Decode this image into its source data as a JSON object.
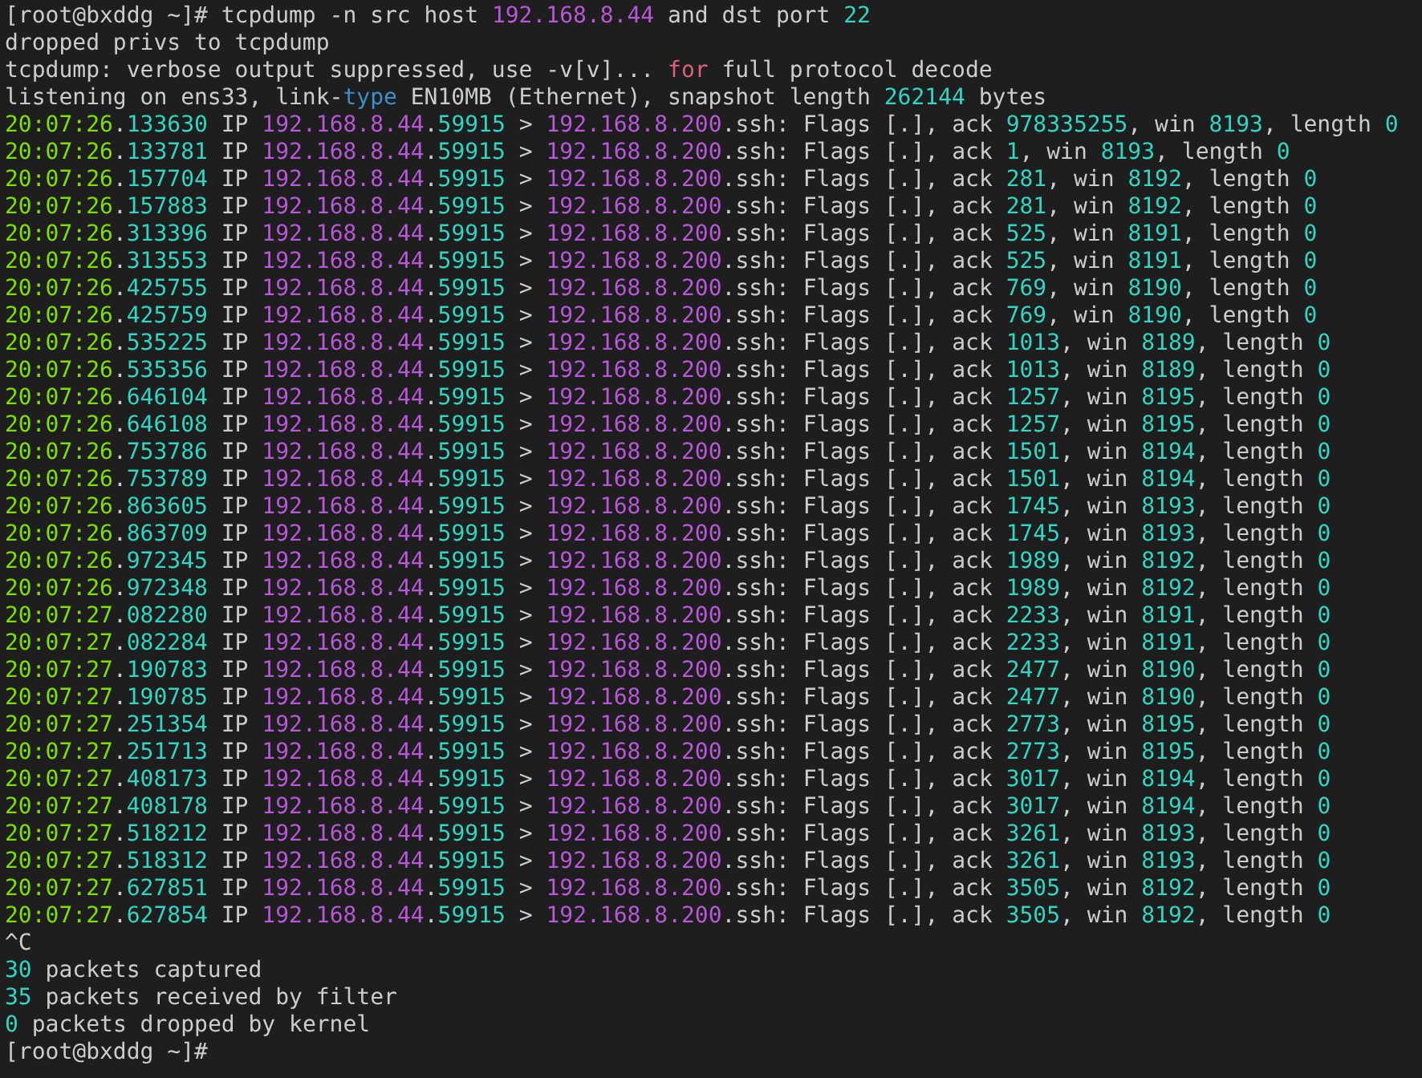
{
  "terminal": {
    "lines": [
      [
        {
          "text": "[root@bxddg ~]# tcpdump -n src host ",
          "kind": "plain"
        },
        {
          "text": "192.168.8.44",
          "kind": "address"
        },
        {
          "text": " and dst port ",
          "kind": "plain"
        },
        {
          "text": "22",
          "kind": "number"
        }
      ],
      [
        {
          "text": "dropped privs to tcpdump",
          "kind": "plain"
        }
      ],
      [
        {
          "text": "tcpdump: verbose output suppressed, use -v[v]... ",
          "kind": "plain"
        },
        {
          "text": "for",
          "kind": "keyword"
        },
        {
          "text": " full protocol decode",
          "kind": "plain"
        }
      ],
      [
        {
          "text": "listening on ens33, link-",
          "kind": "plain"
        },
        {
          "text": "type",
          "kind": "type"
        },
        {
          "text": " EN10MB (Ethernet), snapshot length ",
          "kind": "plain"
        },
        {
          "text": "262144",
          "kind": "number"
        },
        {
          "text": " bytes",
          "kind": "plain"
        }
      ],
      [
        {
          "text": "20:07:26",
          "kind": "time"
        },
        {
          "text": ".",
          "kind": "plain"
        },
        {
          "text": "133630",
          "kind": "number"
        },
        {
          "text": " IP ",
          "kind": "plain"
        },
        {
          "text": "192.168.8.44",
          "kind": "address"
        },
        {
          "text": ".",
          "kind": "plain"
        },
        {
          "text": "59915",
          "kind": "number"
        },
        {
          "text": " > ",
          "kind": "plain"
        },
        {
          "text": "192.168.8.200",
          "kind": "address"
        },
        {
          "text": ".ssh: Flags [.], ack ",
          "kind": "plain"
        },
        {
          "text": "978335255",
          "kind": "number"
        },
        {
          "text": ", win ",
          "kind": "plain"
        },
        {
          "text": "8193",
          "kind": "number"
        },
        {
          "text": ", length ",
          "kind": "plain"
        },
        {
          "text": "0",
          "kind": "number"
        }
      ],
      [
        {
          "text": "20:07:26",
          "kind": "time"
        },
        {
          "text": ".",
          "kind": "plain"
        },
        {
          "text": "133781",
          "kind": "number"
        },
        {
          "text": " IP ",
          "kind": "plain"
        },
        {
          "text": "192.168.8.44",
          "kind": "address"
        },
        {
          "text": ".",
          "kind": "plain"
        },
        {
          "text": "59915",
          "kind": "number"
        },
        {
          "text": " > ",
          "kind": "plain"
        },
        {
          "text": "192.168.8.200",
          "kind": "address"
        },
        {
          "text": ".ssh: Flags [.], ack ",
          "kind": "plain"
        },
        {
          "text": "1",
          "kind": "number"
        },
        {
          "text": ", win ",
          "kind": "plain"
        },
        {
          "text": "8193",
          "kind": "number"
        },
        {
          "text": ", length ",
          "kind": "plain"
        },
        {
          "text": "0",
          "kind": "number"
        }
      ],
      [
        {
          "text": "20:07:26",
          "kind": "time"
        },
        {
          "text": ".",
          "kind": "plain"
        },
        {
          "text": "157704",
          "kind": "number"
        },
        {
          "text": " IP ",
          "kind": "plain"
        },
        {
          "text": "192.168.8.44",
          "kind": "address"
        },
        {
          "text": ".",
          "kind": "plain"
        },
        {
          "text": "59915",
          "kind": "number"
        },
        {
          "text": " > ",
          "kind": "plain"
        },
        {
          "text": "192.168.8.200",
          "kind": "address"
        },
        {
          "text": ".ssh: Flags [.], ack ",
          "kind": "plain"
        },
        {
          "text": "281",
          "kind": "number"
        },
        {
          "text": ", win ",
          "kind": "plain"
        },
        {
          "text": "8192",
          "kind": "number"
        },
        {
          "text": ", length ",
          "kind": "plain"
        },
        {
          "text": "0",
          "kind": "number"
        }
      ],
      [
        {
          "text": "20:07:26",
          "kind": "time"
        },
        {
          "text": ".",
          "kind": "plain"
        },
        {
          "text": "157883",
          "kind": "number"
        },
        {
          "text": " IP ",
          "kind": "plain"
        },
        {
          "text": "192.168.8.44",
          "kind": "address"
        },
        {
          "text": ".",
          "kind": "plain"
        },
        {
          "text": "59915",
          "kind": "number"
        },
        {
          "text": " > ",
          "kind": "plain"
        },
        {
          "text": "192.168.8.200",
          "kind": "address"
        },
        {
          "text": ".ssh: Flags [.], ack ",
          "kind": "plain"
        },
        {
          "text": "281",
          "kind": "number"
        },
        {
          "text": ", win ",
          "kind": "plain"
        },
        {
          "text": "8192",
          "kind": "number"
        },
        {
          "text": ", length ",
          "kind": "plain"
        },
        {
          "text": "0",
          "kind": "number"
        }
      ],
      [
        {
          "text": "20:07:26",
          "kind": "time"
        },
        {
          "text": ".",
          "kind": "plain"
        },
        {
          "text": "313396",
          "kind": "number"
        },
        {
          "text": " IP ",
          "kind": "plain"
        },
        {
          "text": "192.168.8.44",
          "kind": "address"
        },
        {
          "text": ".",
          "kind": "plain"
        },
        {
          "text": "59915",
          "kind": "number"
        },
        {
          "text": " > ",
          "kind": "plain"
        },
        {
          "text": "192.168.8.200",
          "kind": "address"
        },
        {
          "text": ".ssh: Flags [.], ack ",
          "kind": "plain"
        },
        {
          "text": "525",
          "kind": "number"
        },
        {
          "text": ", win ",
          "kind": "plain"
        },
        {
          "text": "8191",
          "kind": "number"
        },
        {
          "text": ", length ",
          "kind": "plain"
        },
        {
          "text": "0",
          "kind": "number"
        }
      ],
      [
        {
          "text": "20:07:26",
          "kind": "time"
        },
        {
          "text": ".",
          "kind": "plain"
        },
        {
          "text": "313553",
          "kind": "number"
        },
        {
          "text": " IP ",
          "kind": "plain"
        },
        {
          "text": "192.168.8.44",
          "kind": "address"
        },
        {
          "text": ".",
          "kind": "plain"
        },
        {
          "text": "59915",
          "kind": "number"
        },
        {
          "text": " > ",
          "kind": "plain"
        },
        {
          "text": "192.168.8.200",
          "kind": "address"
        },
        {
          "text": ".ssh: Flags [.], ack ",
          "kind": "plain"
        },
        {
          "text": "525",
          "kind": "number"
        },
        {
          "text": ", win ",
          "kind": "plain"
        },
        {
          "text": "8191",
          "kind": "number"
        },
        {
          "text": ", length ",
          "kind": "plain"
        },
        {
          "text": "0",
          "kind": "number"
        }
      ],
      [
        {
          "text": "20:07:26",
          "kind": "time"
        },
        {
          "text": ".",
          "kind": "plain"
        },
        {
          "text": "425755",
          "kind": "number"
        },
        {
          "text": " IP ",
          "kind": "plain"
        },
        {
          "text": "192.168.8.44",
          "kind": "address"
        },
        {
          "text": ".",
          "kind": "plain"
        },
        {
          "text": "59915",
          "kind": "number"
        },
        {
          "text": " > ",
          "kind": "plain"
        },
        {
          "text": "192.168.8.200",
          "kind": "address"
        },
        {
          "text": ".ssh: Flags [.], ack ",
          "kind": "plain"
        },
        {
          "text": "769",
          "kind": "number"
        },
        {
          "text": ", win ",
          "kind": "plain"
        },
        {
          "text": "8190",
          "kind": "number"
        },
        {
          "text": ", length ",
          "kind": "plain"
        },
        {
          "text": "0",
          "kind": "number"
        }
      ],
      [
        {
          "text": "20:07:26",
          "kind": "time"
        },
        {
          "text": ".",
          "kind": "plain"
        },
        {
          "text": "425759",
          "kind": "number"
        },
        {
          "text": " IP ",
          "kind": "plain"
        },
        {
          "text": "192.168.8.44",
          "kind": "address"
        },
        {
          "text": ".",
          "kind": "plain"
        },
        {
          "text": "59915",
          "kind": "number"
        },
        {
          "text": " > ",
          "kind": "plain"
        },
        {
          "text": "192.168.8.200",
          "kind": "address"
        },
        {
          "text": ".ssh: Flags [.], ack ",
          "kind": "plain"
        },
        {
          "text": "769",
          "kind": "number"
        },
        {
          "text": ", win ",
          "kind": "plain"
        },
        {
          "text": "8190",
          "kind": "number"
        },
        {
          "text": ", length ",
          "kind": "plain"
        },
        {
          "text": "0",
          "kind": "number"
        }
      ],
      [
        {
          "text": "20:07:26",
          "kind": "time"
        },
        {
          "text": ".",
          "kind": "plain"
        },
        {
          "text": "535225",
          "kind": "number"
        },
        {
          "text": " IP ",
          "kind": "plain"
        },
        {
          "text": "192.168.8.44",
          "kind": "address"
        },
        {
          "text": ".",
          "kind": "plain"
        },
        {
          "text": "59915",
          "kind": "number"
        },
        {
          "text": " > ",
          "kind": "plain"
        },
        {
          "text": "192.168.8.200",
          "kind": "address"
        },
        {
          "text": ".ssh: Flags [.], ack ",
          "kind": "plain"
        },
        {
          "text": "1013",
          "kind": "number"
        },
        {
          "text": ", win ",
          "kind": "plain"
        },
        {
          "text": "8189",
          "kind": "number"
        },
        {
          "text": ", length ",
          "kind": "plain"
        },
        {
          "text": "0",
          "kind": "number"
        }
      ],
      [
        {
          "text": "20:07:26",
          "kind": "time"
        },
        {
          "text": ".",
          "kind": "plain"
        },
        {
          "text": "535356",
          "kind": "number"
        },
        {
          "text": " IP ",
          "kind": "plain"
        },
        {
          "text": "192.168.8.44",
          "kind": "address"
        },
        {
          "text": ".",
          "kind": "plain"
        },
        {
          "text": "59915",
          "kind": "number"
        },
        {
          "text": " > ",
          "kind": "plain"
        },
        {
          "text": "192.168.8.200",
          "kind": "address"
        },
        {
          "text": ".ssh: Flags [.], ack ",
          "kind": "plain"
        },
        {
          "text": "1013",
          "kind": "number"
        },
        {
          "text": ", win ",
          "kind": "plain"
        },
        {
          "text": "8189",
          "kind": "number"
        },
        {
          "text": ", length ",
          "kind": "plain"
        },
        {
          "text": "0",
          "kind": "number"
        }
      ],
      [
        {
          "text": "20:07:26",
          "kind": "time"
        },
        {
          "text": ".",
          "kind": "plain"
        },
        {
          "text": "646104",
          "kind": "number"
        },
        {
          "text": " IP ",
          "kind": "plain"
        },
        {
          "text": "192.168.8.44",
          "kind": "address"
        },
        {
          "text": ".",
          "kind": "plain"
        },
        {
          "text": "59915",
          "kind": "number"
        },
        {
          "text": " > ",
          "kind": "plain"
        },
        {
          "text": "192.168.8.200",
          "kind": "address"
        },
        {
          "text": ".ssh: Flags [.], ack ",
          "kind": "plain"
        },
        {
          "text": "1257",
          "kind": "number"
        },
        {
          "text": ", win ",
          "kind": "plain"
        },
        {
          "text": "8195",
          "kind": "number"
        },
        {
          "text": ", length ",
          "kind": "plain"
        },
        {
          "text": "0",
          "kind": "number"
        }
      ],
      [
        {
          "text": "20:07:26",
          "kind": "time"
        },
        {
          "text": ".",
          "kind": "plain"
        },
        {
          "text": "646108",
          "kind": "number"
        },
        {
          "text": " IP ",
          "kind": "plain"
        },
        {
          "text": "192.168.8.44",
          "kind": "address"
        },
        {
          "text": ".",
          "kind": "plain"
        },
        {
          "text": "59915",
          "kind": "number"
        },
        {
          "text": " > ",
          "kind": "plain"
        },
        {
          "text": "192.168.8.200",
          "kind": "address"
        },
        {
          "text": ".ssh: Flags [.], ack ",
          "kind": "plain"
        },
        {
          "text": "1257",
          "kind": "number"
        },
        {
          "text": ", win ",
          "kind": "plain"
        },
        {
          "text": "8195",
          "kind": "number"
        },
        {
          "text": ", length ",
          "kind": "plain"
        },
        {
          "text": "0",
          "kind": "number"
        }
      ],
      [
        {
          "text": "20:07:26",
          "kind": "time"
        },
        {
          "text": ".",
          "kind": "plain"
        },
        {
          "text": "753786",
          "kind": "number"
        },
        {
          "text": " IP ",
          "kind": "plain"
        },
        {
          "text": "192.168.8.44",
          "kind": "address"
        },
        {
          "text": ".",
          "kind": "plain"
        },
        {
          "text": "59915",
          "kind": "number"
        },
        {
          "text": " > ",
          "kind": "plain"
        },
        {
          "text": "192.168.8.200",
          "kind": "address"
        },
        {
          "text": ".ssh: Flags [.], ack ",
          "kind": "plain"
        },
        {
          "text": "1501",
          "kind": "number"
        },
        {
          "text": ", win ",
          "kind": "plain"
        },
        {
          "text": "8194",
          "kind": "number"
        },
        {
          "text": ", length ",
          "kind": "plain"
        },
        {
          "text": "0",
          "kind": "number"
        }
      ],
      [
        {
          "text": "20:07:26",
          "kind": "time"
        },
        {
          "text": ".",
          "kind": "plain"
        },
        {
          "text": "753789",
          "kind": "number"
        },
        {
          "text": " IP ",
          "kind": "plain"
        },
        {
          "text": "192.168.8.44",
          "kind": "address"
        },
        {
          "text": ".",
          "kind": "plain"
        },
        {
          "text": "59915",
          "kind": "number"
        },
        {
          "text": " > ",
          "kind": "plain"
        },
        {
          "text": "192.168.8.200",
          "kind": "address"
        },
        {
          "text": ".ssh: Flags [.], ack ",
          "kind": "plain"
        },
        {
          "text": "1501",
          "kind": "number"
        },
        {
          "text": ", win ",
          "kind": "plain"
        },
        {
          "text": "8194",
          "kind": "number"
        },
        {
          "text": ", length ",
          "kind": "plain"
        },
        {
          "text": "0",
          "kind": "number"
        }
      ],
      [
        {
          "text": "20:07:26",
          "kind": "time"
        },
        {
          "text": ".",
          "kind": "plain"
        },
        {
          "text": "863605",
          "kind": "number"
        },
        {
          "text": " IP ",
          "kind": "plain"
        },
        {
          "text": "192.168.8.44",
          "kind": "address"
        },
        {
          "text": ".",
          "kind": "plain"
        },
        {
          "text": "59915",
          "kind": "number"
        },
        {
          "text": " > ",
          "kind": "plain"
        },
        {
          "text": "192.168.8.200",
          "kind": "address"
        },
        {
          "text": ".ssh: Flags [.], ack ",
          "kind": "plain"
        },
        {
          "text": "1745",
          "kind": "number"
        },
        {
          "text": ", win ",
          "kind": "plain"
        },
        {
          "text": "8193",
          "kind": "number"
        },
        {
          "text": ", length ",
          "kind": "plain"
        },
        {
          "text": "0",
          "kind": "number"
        }
      ],
      [
        {
          "text": "20:07:26",
          "kind": "time"
        },
        {
          "text": ".",
          "kind": "plain"
        },
        {
          "text": "863709",
          "kind": "number"
        },
        {
          "text": " IP ",
          "kind": "plain"
        },
        {
          "text": "192.168.8.44",
          "kind": "address"
        },
        {
          "text": ".",
          "kind": "plain"
        },
        {
          "text": "59915",
          "kind": "number"
        },
        {
          "text": " > ",
          "kind": "plain"
        },
        {
          "text": "192.168.8.200",
          "kind": "address"
        },
        {
          "text": ".ssh: Flags [.], ack ",
          "kind": "plain"
        },
        {
          "text": "1745",
          "kind": "number"
        },
        {
          "text": ", win ",
          "kind": "plain"
        },
        {
          "text": "8193",
          "kind": "number"
        },
        {
          "text": ", length ",
          "kind": "plain"
        },
        {
          "text": "0",
          "kind": "number"
        }
      ],
      [
        {
          "text": "20:07:26",
          "kind": "time"
        },
        {
          "text": ".",
          "kind": "plain"
        },
        {
          "text": "972345",
          "kind": "number"
        },
        {
          "text": " IP ",
          "kind": "plain"
        },
        {
          "text": "192.168.8.44",
          "kind": "address"
        },
        {
          "text": ".",
          "kind": "plain"
        },
        {
          "text": "59915",
          "kind": "number"
        },
        {
          "text": " > ",
          "kind": "plain"
        },
        {
          "text": "192.168.8.200",
          "kind": "address"
        },
        {
          "text": ".ssh: Flags [.], ack ",
          "kind": "plain"
        },
        {
          "text": "1989",
          "kind": "number"
        },
        {
          "text": ", win ",
          "kind": "plain"
        },
        {
          "text": "8192",
          "kind": "number"
        },
        {
          "text": ", length ",
          "kind": "plain"
        },
        {
          "text": "0",
          "kind": "number"
        }
      ],
      [
        {
          "text": "20:07:26",
          "kind": "time"
        },
        {
          "text": ".",
          "kind": "plain"
        },
        {
          "text": "972348",
          "kind": "number"
        },
        {
          "text": " IP ",
          "kind": "plain"
        },
        {
          "text": "192.168.8.44",
          "kind": "address"
        },
        {
          "text": ".",
          "kind": "plain"
        },
        {
          "text": "59915",
          "kind": "number"
        },
        {
          "text": " > ",
          "kind": "plain"
        },
        {
          "text": "192.168.8.200",
          "kind": "address"
        },
        {
          "text": ".ssh: Flags [.], ack ",
          "kind": "plain"
        },
        {
          "text": "1989",
          "kind": "number"
        },
        {
          "text": ", win ",
          "kind": "plain"
        },
        {
          "text": "8192",
          "kind": "number"
        },
        {
          "text": ", length ",
          "kind": "plain"
        },
        {
          "text": "0",
          "kind": "number"
        }
      ],
      [
        {
          "text": "20:07:27",
          "kind": "time"
        },
        {
          "text": ".",
          "kind": "plain"
        },
        {
          "text": "082280",
          "kind": "number"
        },
        {
          "text": " IP ",
          "kind": "plain"
        },
        {
          "text": "192.168.8.44",
          "kind": "address"
        },
        {
          "text": ".",
          "kind": "plain"
        },
        {
          "text": "59915",
          "kind": "number"
        },
        {
          "text": " > ",
          "kind": "plain"
        },
        {
          "text": "192.168.8.200",
          "kind": "address"
        },
        {
          "text": ".ssh: Flags [.], ack ",
          "kind": "plain"
        },
        {
          "text": "2233",
          "kind": "number"
        },
        {
          "text": ", win ",
          "kind": "plain"
        },
        {
          "text": "8191",
          "kind": "number"
        },
        {
          "text": ", length ",
          "kind": "plain"
        },
        {
          "text": "0",
          "kind": "number"
        }
      ],
      [
        {
          "text": "20:07:27",
          "kind": "time"
        },
        {
          "text": ".",
          "kind": "plain"
        },
        {
          "text": "082284",
          "kind": "number"
        },
        {
          "text": " IP ",
          "kind": "plain"
        },
        {
          "text": "192.168.8.44",
          "kind": "address"
        },
        {
          "text": ".",
          "kind": "plain"
        },
        {
          "text": "59915",
          "kind": "number"
        },
        {
          "text": " > ",
          "kind": "plain"
        },
        {
          "text": "192.168.8.200",
          "kind": "address"
        },
        {
          "text": ".ssh: Flags [.], ack ",
          "kind": "plain"
        },
        {
          "text": "2233",
          "kind": "number"
        },
        {
          "text": ", win ",
          "kind": "plain"
        },
        {
          "text": "8191",
          "kind": "number"
        },
        {
          "text": ", length ",
          "kind": "plain"
        },
        {
          "text": "0",
          "kind": "number"
        }
      ],
      [
        {
          "text": "20:07:27",
          "kind": "time"
        },
        {
          "text": ".",
          "kind": "plain"
        },
        {
          "text": "190783",
          "kind": "number"
        },
        {
          "text": " IP ",
          "kind": "plain"
        },
        {
          "text": "192.168.8.44",
          "kind": "address"
        },
        {
          "text": ".",
          "kind": "plain"
        },
        {
          "text": "59915",
          "kind": "number"
        },
        {
          "text": " > ",
          "kind": "plain"
        },
        {
          "text": "192.168.8.200",
          "kind": "address"
        },
        {
          "text": ".ssh: Flags [.], ack ",
          "kind": "plain"
        },
        {
          "text": "2477",
          "kind": "number"
        },
        {
          "text": ", win ",
          "kind": "plain"
        },
        {
          "text": "8190",
          "kind": "number"
        },
        {
          "text": ", length ",
          "kind": "plain"
        },
        {
          "text": "0",
          "kind": "number"
        }
      ],
      [
        {
          "text": "20:07:27",
          "kind": "time"
        },
        {
          "text": ".",
          "kind": "plain"
        },
        {
          "text": "190785",
          "kind": "number"
        },
        {
          "text": " IP ",
          "kind": "plain"
        },
        {
          "text": "192.168.8.44",
          "kind": "address"
        },
        {
          "text": ".",
          "kind": "plain"
        },
        {
          "text": "59915",
          "kind": "number"
        },
        {
          "text": " > ",
          "kind": "plain"
        },
        {
          "text": "192.168.8.200",
          "kind": "address"
        },
        {
          "text": ".ssh: Flags [.], ack ",
          "kind": "plain"
        },
        {
          "text": "2477",
          "kind": "number"
        },
        {
          "text": ", win ",
          "kind": "plain"
        },
        {
          "text": "8190",
          "kind": "number"
        },
        {
          "text": ", length ",
          "kind": "plain"
        },
        {
          "text": "0",
          "kind": "number"
        }
      ],
      [
        {
          "text": "20:07:27",
          "kind": "time"
        },
        {
          "text": ".",
          "kind": "plain"
        },
        {
          "text": "251354",
          "kind": "number"
        },
        {
          "text": " IP ",
          "kind": "plain"
        },
        {
          "text": "192.168.8.44",
          "kind": "address"
        },
        {
          "text": ".",
          "kind": "plain"
        },
        {
          "text": "59915",
          "kind": "number"
        },
        {
          "text": " > ",
          "kind": "plain"
        },
        {
          "text": "192.168.8.200",
          "kind": "address"
        },
        {
          "text": ".ssh: Flags [.], ack ",
          "kind": "plain"
        },
        {
          "text": "2773",
          "kind": "number"
        },
        {
          "text": ", win ",
          "kind": "plain"
        },
        {
          "text": "8195",
          "kind": "number"
        },
        {
          "text": ", length ",
          "kind": "plain"
        },
        {
          "text": "0",
          "kind": "number"
        }
      ],
      [
        {
          "text": "20:07:27",
          "kind": "time"
        },
        {
          "text": ".",
          "kind": "plain"
        },
        {
          "text": "251713",
          "kind": "number"
        },
        {
          "text": " IP ",
          "kind": "plain"
        },
        {
          "text": "192.168.8.44",
          "kind": "address"
        },
        {
          "text": ".",
          "kind": "plain"
        },
        {
          "text": "59915",
          "kind": "number"
        },
        {
          "text": " > ",
          "kind": "plain"
        },
        {
          "text": "192.168.8.200",
          "kind": "address"
        },
        {
          "text": ".ssh: Flags [.], ack ",
          "kind": "plain"
        },
        {
          "text": "2773",
          "kind": "number"
        },
        {
          "text": ", win ",
          "kind": "plain"
        },
        {
          "text": "8195",
          "kind": "number"
        },
        {
          "text": ", length ",
          "kind": "plain"
        },
        {
          "text": "0",
          "kind": "number"
        }
      ],
      [
        {
          "text": "20:07:27",
          "kind": "time"
        },
        {
          "text": ".",
          "kind": "plain"
        },
        {
          "text": "408173",
          "kind": "number"
        },
        {
          "text": " IP ",
          "kind": "plain"
        },
        {
          "text": "192.168.8.44",
          "kind": "address"
        },
        {
          "text": ".",
          "kind": "plain"
        },
        {
          "text": "59915",
          "kind": "number"
        },
        {
          "text": " > ",
          "kind": "plain"
        },
        {
          "text": "192.168.8.200",
          "kind": "address"
        },
        {
          "text": ".ssh: Flags [.], ack ",
          "kind": "plain"
        },
        {
          "text": "3017",
          "kind": "number"
        },
        {
          "text": ", win ",
          "kind": "plain"
        },
        {
          "text": "8194",
          "kind": "number"
        },
        {
          "text": ", length ",
          "kind": "plain"
        },
        {
          "text": "0",
          "kind": "number"
        }
      ],
      [
        {
          "text": "20:07:27",
          "kind": "time"
        },
        {
          "text": ".",
          "kind": "plain"
        },
        {
          "text": "408178",
          "kind": "number"
        },
        {
          "text": " IP ",
          "kind": "plain"
        },
        {
          "text": "192.168.8.44",
          "kind": "address"
        },
        {
          "text": ".",
          "kind": "plain"
        },
        {
          "text": "59915",
          "kind": "number"
        },
        {
          "text": " > ",
          "kind": "plain"
        },
        {
          "text": "192.168.8.200",
          "kind": "address"
        },
        {
          "text": ".ssh: Flags [.], ack ",
          "kind": "plain"
        },
        {
          "text": "3017",
          "kind": "number"
        },
        {
          "text": ", win ",
          "kind": "plain"
        },
        {
          "text": "8194",
          "kind": "number"
        },
        {
          "text": ", length ",
          "kind": "plain"
        },
        {
          "text": "0",
          "kind": "number"
        }
      ],
      [
        {
          "text": "20:07:27",
          "kind": "time"
        },
        {
          "text": ".",
          "kind": "plain"
        },
        {
          "text": "518212",
          "kind": "number"
        },
        {
          "text": " IP ",
          "kind": "plain"
        },
        {
          "text": "192.168.8.44",
          "kind": "address"
        },
        {
          "text": ".",
          "kind": "plain"
        },
        {
          "text": "59915",
          "kind": "number"
        },
        {
          "text": " > ",
          "kind": "plain"
        },
        {
          "text": "192.168.8.200",
          "kind": "address"
        },
        {
          "text": ".ssh: Flags [.], ack ",
          "kind": "plain"
        },
        {
          "text": "3261",
          "kind": "number"
        },
        {
          "text": ", win ",
          "kind": "plain"
        },
        {
          "text": "8193",
          "kind": "number"
        },
        {
          "text": ", length ",
          "kind": "plain"
        },
        {
          "text": "0",
          "kind": "number"
        }
      ],
      [
        {
          "text": "20:07:27",
          "kind": "time"
        },
        {
          "text": ".",
          "kind": "plain"
        },
        {
          "text": "518312",
          "kind": "number"
        },
        {
          "text": " IP ",
          "kind": "plain"
        },
        {
          "text": "192.168.8.44",
          "kind": "address"
        },
        {
          "text": ".",
          "kind": "plain"
        },
        {
          "text": "59915",
          "kind": "number"
        },
        {
          "text": " > ",
          "kind": "plain"
        },
        {
          "text": "192.168.8.200",
          "kind": "address"
        },
        {
          "text": ".ssh: Flags [.], ack ",
          "kind": "plain"
        },
        {
          "text": "3261",
          "kind": "number"
        },
        {
          "text": ", win ",
          "kind": "plain"
        },
        {
          "text": "8193",
          "kind": "number"
        },
        {
          "text": ", length ",
          "kind": "plain"
        },
        {
          "text": "0",
          "kind": "number"
        }
      ],
      [
        {
          "text": "20:07:27",
          "kind": "time"
        },
        {
          "text": ".",
          "kind": "plain"
        },
        {
          "text": "627851",
          "kind": "number"
        },
        {
          "text": " IP ",
          "kind": "plain"
        },
        {
          "text": "192.168.8.44",
          "kind": "address"
        },
        {
          "text": ".",
          "kind": "plain"
        },
        {
          "text": "59915",
          "kind": "number"
        },
        {
          "text": " > ",
          "kind": "plain"
        },
        {
          "text": "192.168.8.200",
          "kind": "address"
        },
        {
          "text": ".ssh: Flags [.], ack ",
          "kind": "plain"
        },
        {
          "text": "3505",
          "kind": "number"
        },
        {
          "text": ", win ",
          "kind": "plain"
        },
        {
          "text": "8192",
          "kind": "number"
        },
        {
          "text": ", length ",
          "kind": "plain"
        },
        {
          "text": "0",
          "kind": "number"
        }
      ],
      [
        {
          "text": "20:07:27",
          "kind": "time"
        },
        {
          "text": ".",
          "kind": "plain"
        },
        {
          "text": "627854",
          "kind": "number"
        },
        {
          "text": " IP ",
          "kind": "plain"
        },
        {
          "text": "192.168.8.44",
          "kind": "address"
        },
        {
          "text": ".",
          "kind": "plain"
        },
        {
          "text": "59915",
          "kind": "number"
        },
        {
          "text": " > ",
          "kind": "plain"
        },
        {
          "text": "192.168.8.200",
          "kind": "address"
        },
        {
          "text": ".ssh: Flags [.], ack ",
          "kind": "plain"
        },
        {
          "text": "3505",
          "kind": "number"
        },
        {
          "text": ", win ",
          "kind": "plain"
        },
        {
          "text": "8192",
          "kind": "number"
        },
        {
          "text": ", length ",
          "kind": "plain"
        },
        {
          "text": "0",
          "kind": "number"
        }
      ],
      [
        {
          "text": "^C",
          "kind": "plain"
        }
      ],
      [
        {
          "text": "30",
          "kind": "number"
        },
        {
          "text": " packets captured",
          "kind": "plain"
        }
      ],
      [
        {
          "text": "35",
          "kind": "number"
        },
        {
          "text": " packets received by filter",
          "kind": "plain"
        }
      ],
      [
        {
          "text": "0",
          "kind": "number"
        },
        {
          "text": " packets dropped by kernel",
          "kind": "plain"
        }
      ],
      [
        {
          "text": "[root@bxddg ~]#",
          "kind": "plain"
        }
      ]
    ]
  }
}
